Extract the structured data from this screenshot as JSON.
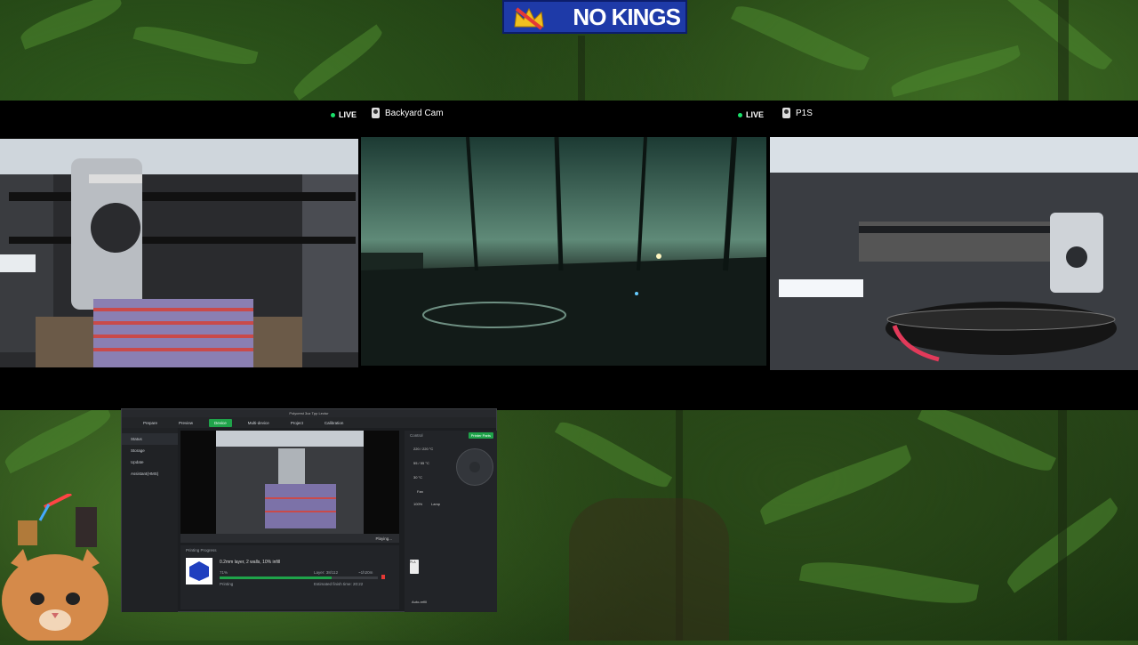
{
  "banner": {
    "text": "NO KINGS"
  },
  "cameras": [
    {
      "name": "",
      "live_label": "LIVE"
    },
    {
      "name": "Backyard Cam",
      "live_label": "LIVE"
    },
    {
      "name": "P1S",
      "live_label": ""
    }
  ],
  "software": {
    "window_title": "Polycrest 3oz Tpp Lectur",
    "tabs": [
      "Prepare",
      "Preview",
      "Device",
      "Multi-device",
      "Project",
      "Calibration"
    ],
    "active_tab": "Device",
    "sidebar": [
      "Status",
      "Storage",
      "Update",
      "Assistant(HMS)"
    ],
    "video_status": "Playing...",
    "progress_header": "Printing Progress",
    "job_name": "0.2mm layer, 2 walls, 10% infill",
    "layer_text": "Layer: 38/112",
    "time_text": "~1h20m",
    "percent": "71%",
    "state": "Printing",
    "finish_time": "Estimated finish time: 20:22",
    "progress_fraction": 0.71,
    "control_header": "Control",
    "printer_parts": "Printer Parts",
    "nozzle_temp": "220 / 220 °C",
    "bed_temp": "55 / 55 °C",
    "chamber_temp": "30 °C",
    "fan_label": "Fan",
    "fan_value": "100%",
    "lamp_label": "Lamp",
    "filaments": [
      {
        "label": "PLA",
        "color": "#e53935"
      },
      {
        "label": "PLA",
        "color": "#1fa34a"
      },
      {
        "label": "PLA",
        "color": "#2f6bd8"
      },
      {
        "label": "PLA",
        "color": "#ececec"
      }
    ],
    "auto_refill": "Auto-refill"
  },
  "colors": {
    "accent": "#1fa34a",
    "live": "#19e06a",
    "banner": "#1e3aa8"
  }
}
